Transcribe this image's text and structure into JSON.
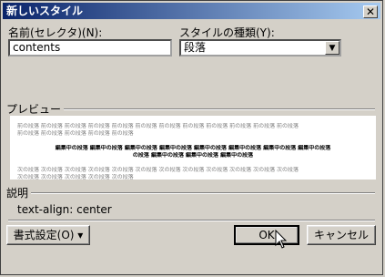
{
  "dialog": {
    "title": "新しいスタイル",
    "close_label": "✕"
  },
  "name_field": {
    "label": "名前(セレクタ)(N):",
    "value": "contents"
  },
  "style_type": {
    "label": "スタイルの種類(Y):",
    "selected": "段落"
  },
  "preview": {
    "label": "プレビュー",
    "before_lines": [
      "前の段落 前の段落 前の段落 前の段落 前の段落 前の段落 前の段落 前の段落 前の段落 前の段落 前の段落 前の段落",
      "前の段落 前の段落 前の段落 前の段落 前の段落"
    ],
    "current_lines": [
      "編集中の段落 編集中の段落 編集中の段落 編集中の段落 編集中の段落 編集中の段落 編集中の段落 編集中の段落",
      "の段落 編集中の段落 編集中の段落 編集中の段落"
    ],
    "after_lines": [
      "次の段落 次の段落 次の段落 次の段落 次の段落 次の段落 次の段落 次の段落 次の段落 次の段落 次の段落 次の段落",
      "次の段落 次の段落 次の段落 次の段落 次の段落"
    ]
  },
  "description": {
    "label": "説明",
    "text": "text-align: center"
  },
  "buttons": {
    "format": "書式設定(O) ▾",
    "ok": "OK",
    "cancel": "キャンセル"
  }
}
